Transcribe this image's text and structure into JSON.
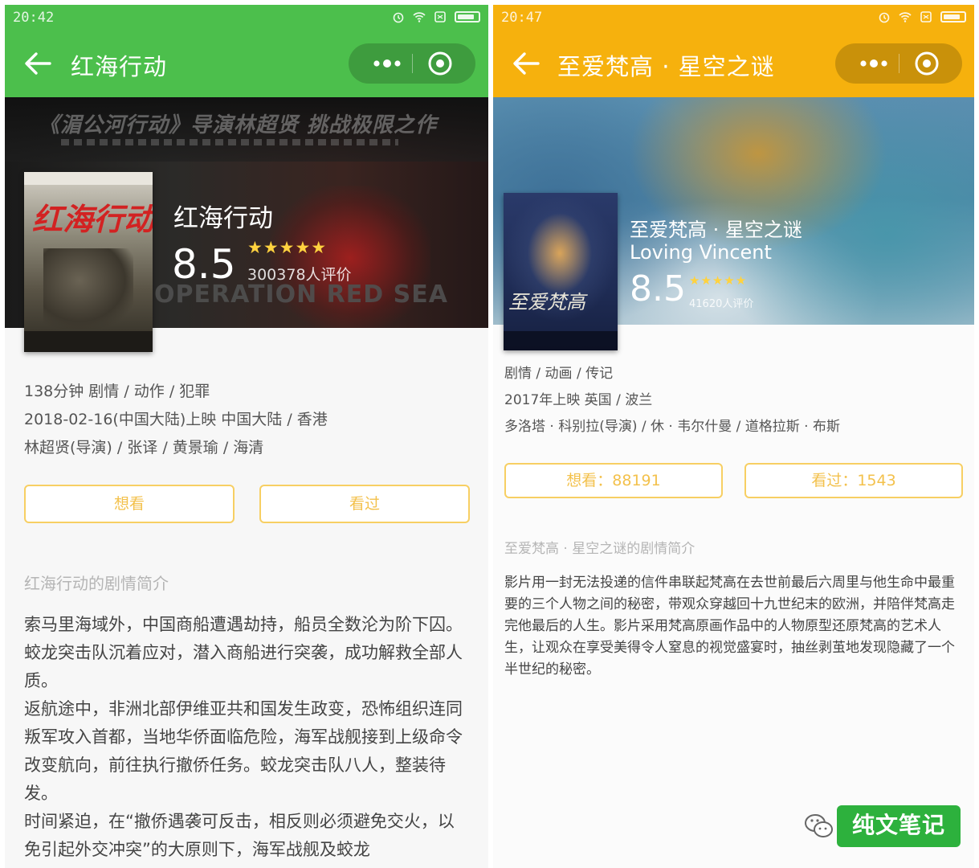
{
  "left": {
    "accent": "#4cbf4c",
    "status": {
      "time": "20:42"
    },
    "nav": {
      "title": "红海行动"
    },
    "hero": {
      "banner_text": "《湄公河行动》导演林超贤 挑战极限之作",
      "poster_title": "红海行动",
      "poster_en": "OPERATION RED SEA",
      "title": "红海行动",
      "rating": "8.5",
      "stars": "★★★★★",
      "votes": "300378人评价"
    },
    "info": [
      "138分钟 剧情 / 动作 / 犯罪",
      "2018-02-16(中国大陆)上映 中国大陆 / 香港",
      "林超贤(导演) / 张译 / 黄景瑜 / 海清"
    ],
    "buttons": {
      "want": "想看",
      "seen": "看过"
    },
    "synopsis_title": "红海行动的剧情简介",
    "synopsis": [
      "索马里海域外，中国商船遭遇劫持，船员全数沦为阶下囚。蛟龙突击队沉着应对，潜入商船进行突袭，成功解救全部人质。",
      "返航途中，非洲北部伊维亚共和国发生政变，恐怖组织连同叛军攻入首都，当地华侨面临危险，海军战舰接到上级命令改变航向，前往执行撤侨任务。蛟龙突击队八人，整装待发。",
      "时间紧迫，在“撤侨遇袭可反击，相反则必须避免交火，以免引起外交冲突”的大原则下，海军战舰及蛟龙"
    ]
  },
  "right": {
    "accent": "#f6b10d",
    "status": {
      "time": "20:47"
    },
    "nav": {
      "title": "至爱梵高 · 星空之谜"
    },
    "hero": {
      "poster_title": "至爱梵高",
      "title": "至爱梵高 · 星空之谜",
      "subtitle": "Loving Vincent",
      "rating": "8.5",
      "stars": "★★★★★",
      "votes": "41620人评价"
    },
    "info": [
      "剧情 / 动画 / 传记",
      "2017年上映 英国 / 波兰",
      "多洛塔 · 科别拉(导演) / 休 · 韦尔什曼 / 道格拉斯 · 布斯"
    ],
    "buttons": {
      "want": "想看：88191",
      "seen": "看过：1543"
    },
    "synopsis_title": "至爱梵高 · 星空之谜的剧情简介",
    "synopsis": [
      "影片用一封无法投递的信件串联起梵高在去世前最后六周里与他生命中最重要的三个人物之间的秘密，带观众穿越回十九世纪末的欧洲，并陪伴梵高走完他最后的人生。影片采用梵高原画作品中的人物原型还原梵高的艺术人生，让观众在享受美得令人窒息的视觉盛宴时，抽丝剥茧地发现隐藏了一个半世纪的秘密。"
    ]
  },
  "watermark": {
    "text": "纯文笔记"
  }
}
